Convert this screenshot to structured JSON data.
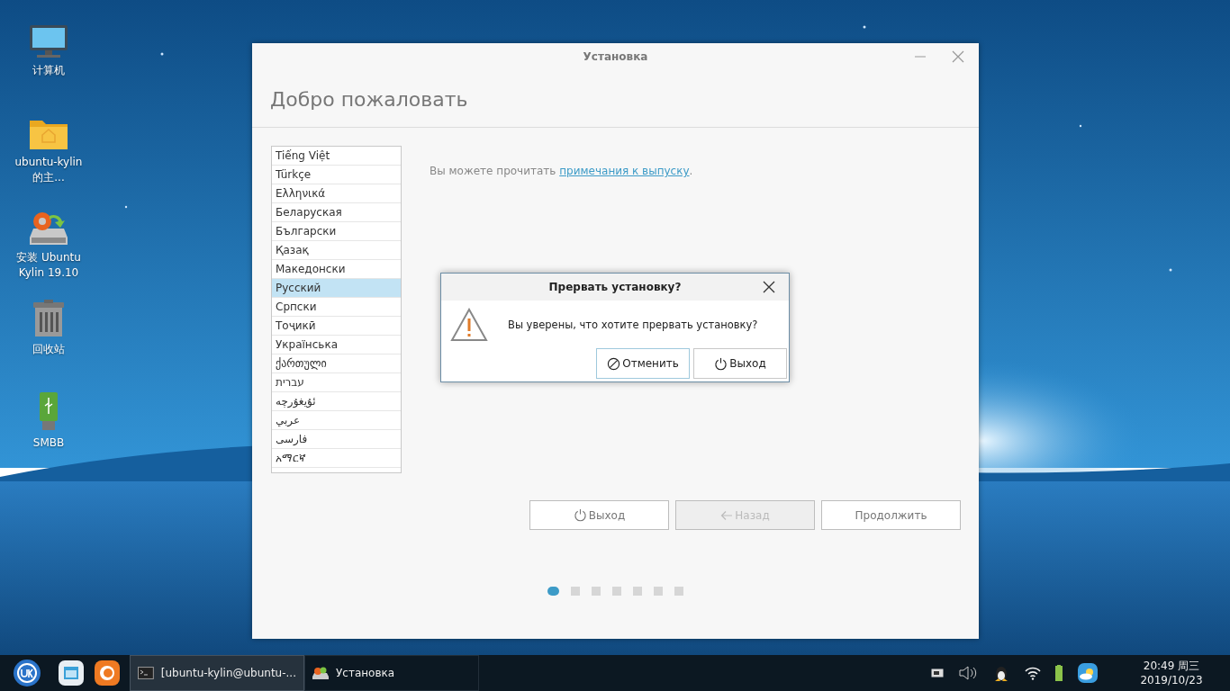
{
  "desktop_icons": [
    {
      "label": "计算机",
      "kind": "computer"
    },
    {
      "label": "ubuntu-kylin 的主...",
      "kind": "folder"
    },
    {
      "label": "安装 Ubuntu Kylin 19.10",
      "kind": "installer"
    },
    {
      "label": "回收站",
      "kind": "trash"
    },
    {
      "label": "SMBB",
      "kind": "usb"
    }
  ],
  "window": {
    "title": "Установка",
    "heading": "Добро пожаловать",
    "languages": [
      {
        "label": "Tiếng Việt",
        "selected": false
      },
      {
        "label": "Türkçe",
        "selected": false
      },
      {
        "label": "Ελληνικά",
        "selected": false
      },
      {
        "label": "Беларуская",
        "selected": false
      },
      {
        "label": "Български",
        "selected": false
      },
      {
        "label": "Қазақ",
        "selected": false
      },
      {
        "label": "Македонски",
        "selected": false
      },
      {
        "label": "Русский",
        "selected": true
      },
      {
        "label": "Српски",
        "selected": false
      },
      {
        "label": "Тоҷикӣ",
        "selected": false
      },
      {
        "label": "Українська",
        "selected": false
      },
      {
        "label": "ქართული",
        "selected": false
      },
      {
        "label": "עברית",
        "selected": false
      },
      {
        "label": "ئۇيغۇرچە",
        "selected": false
      },
      {
        "label": "عربي",
        "selected": false
      },
      {
        "label": "فارسی",
        "selected": false
      },
      {
        "label": "አማርኛ",
        "selected": false
      }
    ],
    "notes": {
      "before": "Вы можете прочитать",
      "link": "примечания к выпуску",
      "after": "."
    },
    "buttons": [
      {
        "label": "Выход",
        "kind": "quit",
        "disabled": false
      },
      {
        "label": "Назад",
        "kind": "back",
        "disabled": true
      },
      {
        "label": "Продолжить",
        "kind": "continue",
        "disabled": false
      }
    ],
    "steps": [
      {
        "selected": true
      },
      {
        "selected": false
      },
      {
        "selected": false
      },
      {
        "selected": false
      },
      {
        "selected": false
      },
      {
        "selected": false
      },
      {
        "selected": false
      }
    ]
  },
  "dialog": {
    "title": "Прервать установку?",
    "message": "Вы уверены, что хотите прервать установку?",
    "buttons": [
      {
        "label": "Отменить",
        "kind": "cancel",
        "focused": true
      },
      {
        "label": "Выход",
        "kind": "quit",
        "focused": false
      }
    ]
  },
  "taskbar": {
    "tasks": [
      {
        "label": "[ubuntu-kylin@ubuntu-...",
        "kind": "terminal",
        "selected": true
      },
      {
        "label": "Установка",
        "kind": "installer",
        "selected": false
      }
    ],
    "time": "20:49 周三",
    "date": "2019/10/23"
  }
}
